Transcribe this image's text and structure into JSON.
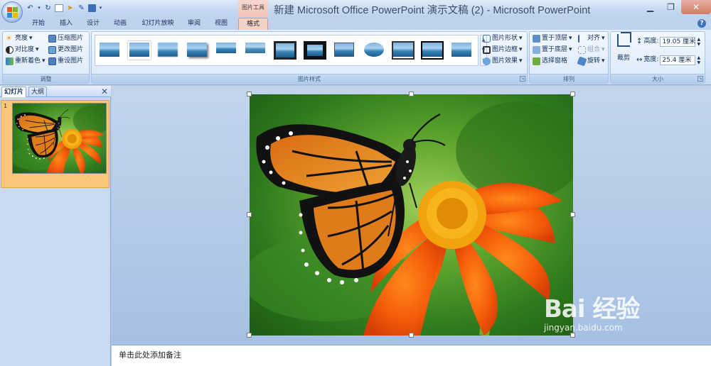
{
  "window": {
    "title": "新建 Microsoft Office PowerPoint 演示文稿 (2) - Microsoft PowerPoint",
    "context_tool_label": "图片工具"
  },
  "quick_access": {
    "save_icon": "save-icon",
    "undo_icon": "undo-icon",
    "redo_icon": "redo-icon"
  },
  "tabs": [
    {
      "label": "开始"
    },
    {
      "label": "插入"
    },
    {
      "label": "设计"
    },
    {
      "label": "动画"
    },
    {
      "label": "幻灯片放映"
    },
    {
      "label": "审阅"
    },
    {
      "label": "视图"
    },
    {
      "label": "格式",
      "active": true
    }
  ],
  "ribbon": {
    "adjust": {
      "label": "调整",
      "brightness": "亮度",
      "contrast": "对比度",
      "recolor": "重新着色",
      "compress": "压缩图片",
      "change_picture": "更改图片",
      "reset_picture": "重设图片"
    },
    "picture_styles": {
      "label": "图片样式",
      "shape": "图片形状",
      "border": "图片边框",
      "effects": "图片效果"
    },
    "arrange": {
      "label": "排列",
      "bring_front": "置于顶层",
      "send_back": "置于底层",
      "selection_pane": "选择窗格",
      "align": "对齐",
      "group": "组合",
      "rotate": "旋转"
    },
    "size": {
      "label": "大小",
      "crop": "裁剪",
      "height_label": "高度:",
      "height_value": "19.05 厘米",
      "width_label": "宽度:",
      "width_value": "25.4 厘米"
    }
  },
  "left_pane": {
    "tab_slides": "幻灯片",
    "tab_outline": "大纲",
    "slide_number": "1"
  },
  "notes": {
    "placeholder": "单击此处添加备注"
  },
  "watermark": {
    "text": "Bai 经验",
    "url": "jingyan.baidu.com"
  },
  "colors": {
    "active_tab": "#f2d1c7",
    "close_button": "#d27b62",
    "selected_thumbnail": "#f8c77c"
  }
}
